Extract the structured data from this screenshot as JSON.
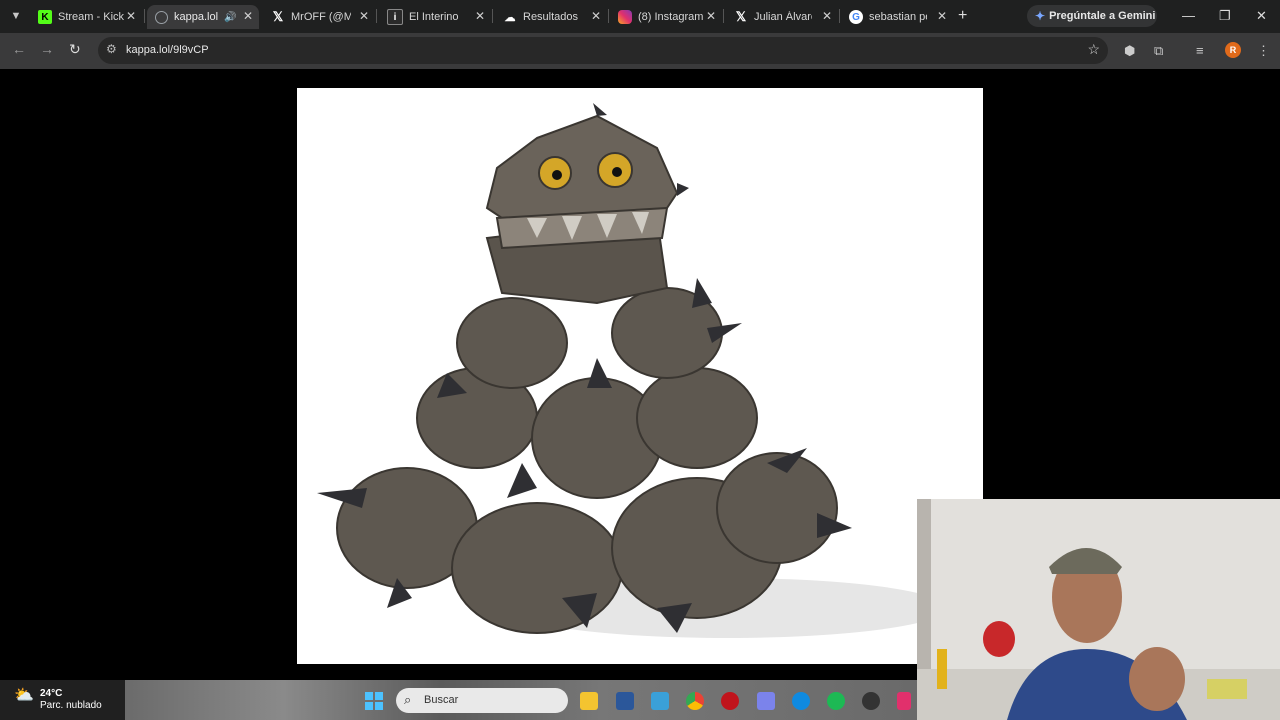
{
  "browser": {
    "tabs": [
      {
        "title": "Stream - Kick",
        "icon": "kick-icon",
        "color": "#53fc18"
      },
      {
        "title": "kappa.lol/",
        "icon": "globe-icon",
        "color": "#9aa0a6",
        "active": true
      },
      {
        "title": "MrOFF (@Mr",
        "icon": "x-icon",
        "color": "#ffffff"
      },
      {
        "title": "El Interino",
        "icon": "site-icon",
        "color": "#2a2a2a"
      },
      {
        "title": "Resultados C",
        "icon": "cloud-icon",
        "color": "#ffffff"
      },
      {
        "title": "(8) Instagram",
        "icon": "instagram-icon",
        "color": "#e1306c"
      },
      {
        "title": "Julian Álvarez",
        "icon": "x-icon",
        "color": "#ffffff"
      },
      {
        "title": "sebastian per",
        "icon": "google-icon",
        "color": "#ffffff"
      }
    ],
    "gemini_label": "Pregúntale a Gemini",
    "url": "kappa.lol/9l9vCP",
    "profile_initial": "R"
  },
  "taskbar": {
    "weather_temp": "24°C",
    "weather_desc": "Parc. nublado",
    "search_placeholder": "Buscar"
  },
  "colors": {
    "tabbar": "#1f2020",
    "toolbar": "#3a3a3b",
    "avatar": "#e06a1b"
  }
}
